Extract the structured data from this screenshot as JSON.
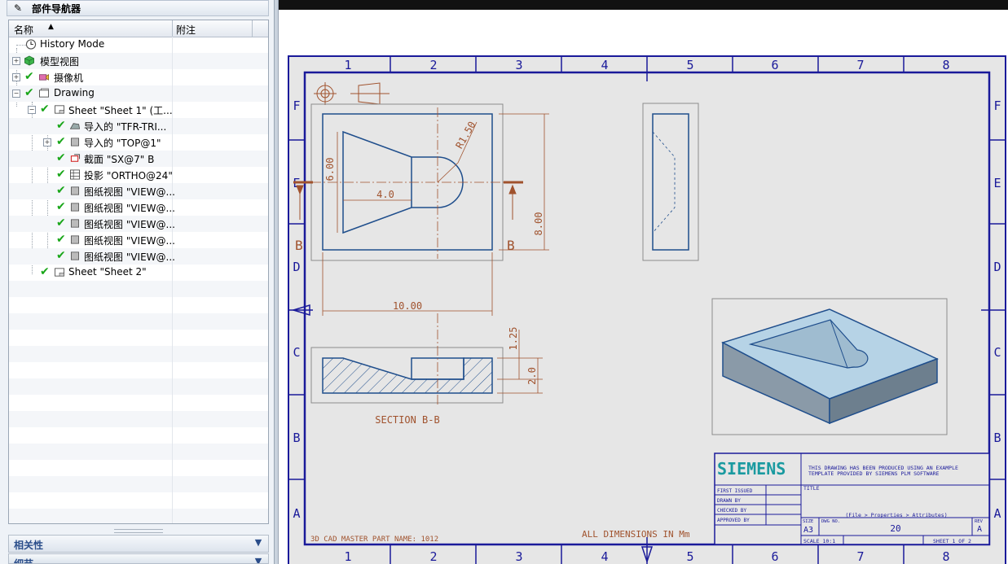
{
  "navigator": {
    "title": "部件导航器",
    "pin_icon": "pin-icon",
    "columns": {
      "name": "名称",
      "notes": "附注"
    },
    "nodes": [
      {
        "label": "History Mode",
        "icon": "clock-icon"
      },
      {
        "label": "模型视图",
        "icon": "model-views-icon"
      },
      {
        "label": "摄像机",
        "icon": "camera-icon"
      },
      {
        "label": "Drawing",
        "icon": "drawing-icon"
      },
      {
        "label": "Sheet \"Sheet 1\" (工...",
        "icon": "sheet-icon"
      },
      {
        "label": "导入的 \"TFR-TRI...",
        "icon": "imported-view-icon"
      },
      {
        "label": "导入的 \"TOP@1\"",
        "icon": "imported-view-icon"
      },
      {
        "label": "截面 \"SX@7\" B",
        "icon": "section-icon"
      },
      {
        "label": "投影 \"ORTHO@24\"",
        "icon": "projection-icon"
      },
      {
        "label": "图纸视图 \"VIEW@...",
        "icon": "drawing-view-icon"
      },
      {
        "label": "图纸视图 \"VIEW@...",
        "icon": "drawing-view-icon"
      },
      {
        "label": "图纸视图 \"VIEW@...",
        "icon": "drawing-view-icon"
      },
      {
        "label": "图纸视图 \"VIEW@...",
        "icon": "drawing-view-icon"
      },
      {
        "label": "图纸视图 \"VIEW@...",
        "icon": "drawing-view-icon"
      },
      {
        "label": "Sheet \"Sheet 2\"",
        "icon": "sheet-icon"
      }
    ],
    "panels": {
      "dependencies": "相关性",
      "details": "细节"
    }
  },
  "drawing": {
    "zone_columns": [
      "1",
      "2",
      "3",
      "4",
      "5",
      "6",
      "7",
      "8"
    ],
    "zone_rows": [
      "F",
      "E",
      "D",
      "C",
      "B",
      "A"
    ],
    "dimensions": {
      "width": "10.00",
      "height": "8.00",
      "radius": "R1.50",
      "inner_width": "4.0",
      "inner_height": "6.00",
      "section_top": "1.25",
      "section_depth": "2.0"
    },
    "section_label": "SECTION B-B",
    "section_marker": "B",
    "master_part": "3D CAD MASTER PART NAME: 1012",
    "units_note": "ALL DIMENSIONS IN Mm",
    "title_block": {
      "brand": "SIEMENS",
      "note": "THIS DRAWING HAS BEEN PRODUCED USING AN EXAMPLE TEMPLATE PROVIDED BY SIEMENS PLM SOFTWARE",
      "title_label": "TITLE",
      "first_issued": "FIRST ISSUED",
      "drawn_by": "DRAWN BY",
      "checked_by": "CHECKED BY",
      "approved_by": "APPROVED BY",
      "size_label": "SIZE",
      "dwg_label": "DWG NO.",
      "rev_label": "REV",
      "attributes": "(File > Properties > Attributes)",
      "size": "A3",
      "dwg_no": "20",
      "rev": "A",
      "scale": "SCALE 10:1",
      "sheet": "SHEET 1 OF 2"
    },
    "colors": {
      "border": "#1a1a9a",
      "geometry": "#1f4e8c",
      "dimension": "#a0522d",
      "brand": "#1a9aa0",
      "sheet_bg": "#e6e6e6"
    }
  }
}
